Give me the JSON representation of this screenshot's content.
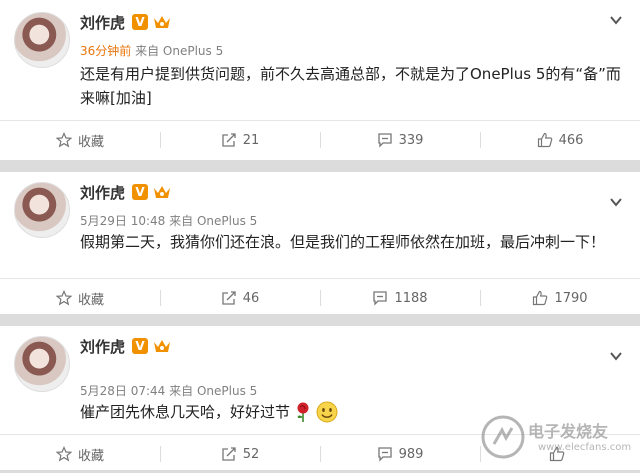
{
  "posts": [
    {
      "author": "刘作虎",
      "badge": "V",
      "time": "36分钟前",
      "source": "来自 OnePlus 5",
      "text_lines": [
        "还是有用户提到供货问题，前不久去高通总部，不就是为了OnePlus 5的有“备”而",
        "来嘛[加油]"
      ],
      "actions": {
        "favorite": "收藏",
        "repost": "21",
        "comment": "339",
        "like": "466"
      }
    },
    {
      "author": "刘作虎",
      "badge": "V",
      "time": "5月29日 10:48",
      "source": "来自 OnePlus 5",
      "text_lines": [
        "假期第二天，我猜你们还在浪。但是我们的工程师依然在加班，最后冲刺一下！"
      ],
      "actions": {
        "favorite": "收藏",
        "repost": "46",
        "comment": "1188",
        "like": "1790"
      }
    },
    {
      "author": "刘作虎",
      "badge": "V",
      "time": "5月28日 07:44",
      "source": "来自 OnePlus 5",
      "text_lines": [
        "催产团先休息几天哈，好好过节"
      ],
      "actions": {
        "favorite": "收藏",
        "repost": "52",
        "comment": "989",
        "like": ""
      }
    }
  ],
  "watermark": {
    "title": "电子发烧友",
    "url": "www.elecfans.com"
  },
  "colors": {
    "badge": "#f29100",
    "new_time": "#e8750b",
    "divider": "#dcdcdc"
  }
}
